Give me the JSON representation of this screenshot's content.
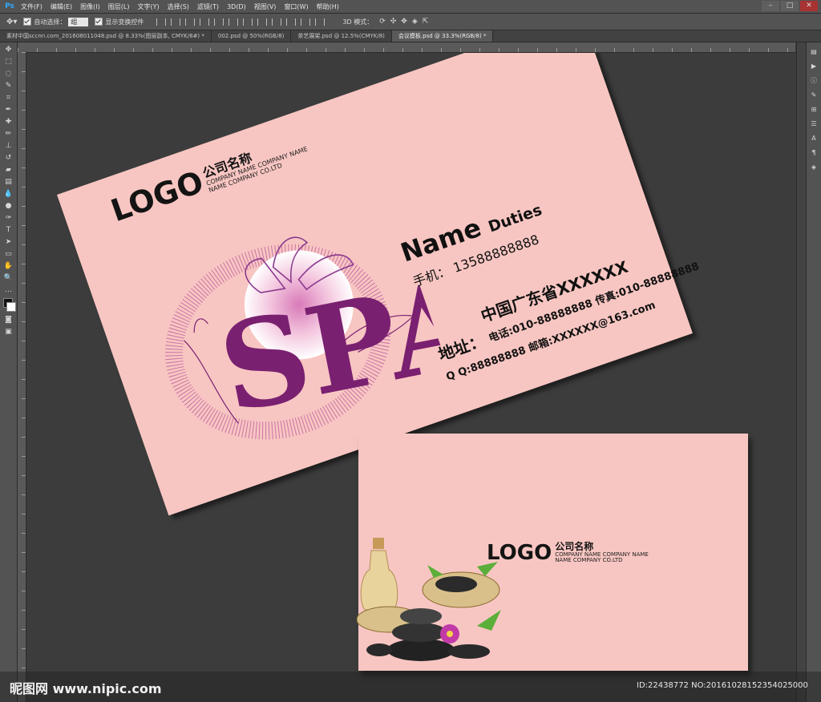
{
  "app": {
    "name": "Ps"
  },
  "menu": [
    "文件(F)",
    "编辑(E)",
    "图像(I)",
    "图层(L)",
    "文字(Y)",
    "选择(S)",
    "滤镜(T)",
    "3D(D)",
    "视图(V)",
    "窗口(W)",
    "帮助(H)"
  ],
  "options": {
    "auto_select_label": "自动选择：",
    "auto_select_value": "组",
    "show_transform_label": "显示变换控件",
    "mode_3d_label": "3D 模式："
  },
  "tabs": [
    {
      "label": "素材中国sccnn.com_2016080110​48.psd @ 8.33%(图层副本, CMYK/8#) *"
    },
    {
      "label": "002.psd @ 50%(RGB/8)"
    },
    {
      "label": "茶艺展架.psd @ 12.5%(CMYK/8)"
    },
    {
      "label": "会议模板.psd @ 33.3%(RGB/8) *",
      "active": true
    }
  ],
  "card_front": {
    "logo": "LOGO",
    "company_cn": "公司名称",
    "company_en_1": "COMPANY NAME COMPANY NAME",
    "company_en_2": "NAME COMPANY CO.LTD",
    "name": "Name",
    "duties": "Duties",
    "mobile": "手机：  13588888888",
    "province": "中国广东省XXXXXX",
    "address_label": "地址：",
    "phone_fax": "电话:010-88888888  传真:010-88888888",
    "qq_email": "Q Q:88888888  邮箱:XXXXXX@163.com",
    "spa": "SPA"
  },
  "card_back": {
    "logo": "LOGO",
    "company_cn": "公司名称",
    "company_en_1": "COMPANY NAME COMPANY NAME",
    "company_en_2": "NAME COMPANY CO.LTD"
  },
  "footer": {
    "watermark": "昵图网 www.nipic.com",
    "id": "ID:22438772 NO:20161028152354025000"
  },
  "colors": {
    "card": "#f8c6c2",
    "spa_purple": "#7a2070",
    "ui_panel": "#535353",
    "canvas_bg": "#3c3c3c"
  }
}
